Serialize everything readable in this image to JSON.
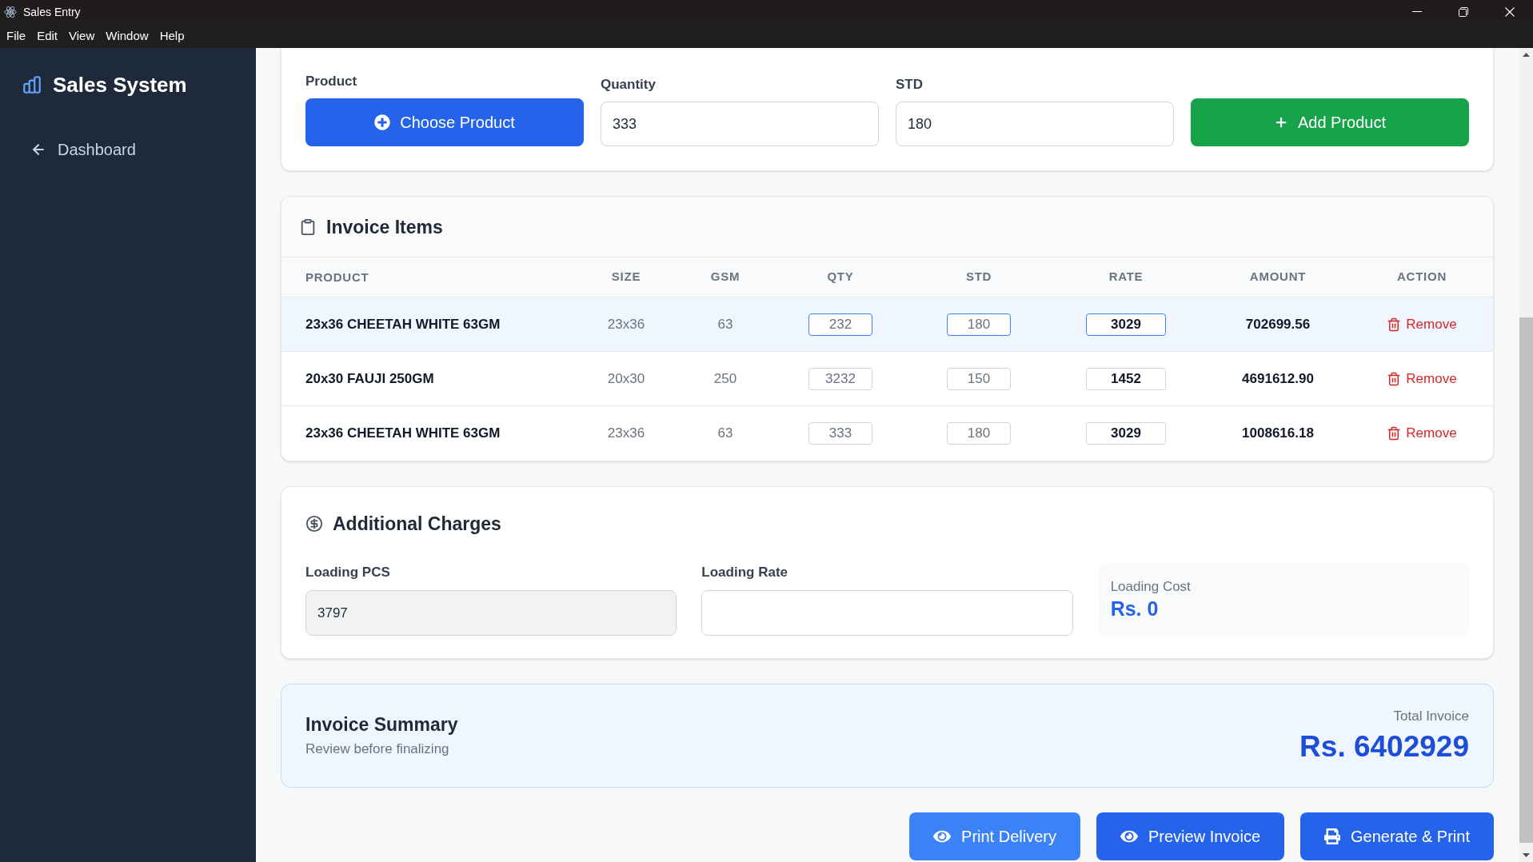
{
  "window": {
    "title": "Sales Entry"
  },
  "menu": [
    "File",
    "Edit",
    "View",
    "Window",
    "Help"
  ],
  "sidebar": {
    "brand": "Sales System",
    "items": [
      {
        "label": "Dashboard"
      }
    ]
  },
  "product_form": {
    "product": {
      "label": "Product",
      "button": "Choose Product"
    },
    "quantity": {
      "label": "Quantity",
      "value": "333"
    },
    "std": {
      "label": "STD",
      "value": "180"
    },
    "add_button": "Add Product"
  },
  "invoice_items": {
    "title": "Invoice Items",
    "columns": [
      "PRODUCT",
      "SIZE",
      "GSM",
      "QTY",
      "STD",
      "RATE",
      "AMOUNT",
      "ACTION"
    ],
    "rows": [
      {
        "product": "23x36 CHEETAH WHITE 63GM",
        "size": "23x36",
        "gsm": "63",
        "qty": "232",
        "std": "180",
        "rate": "3029",
        "amount": "702699.56",
        "action": "Remove",
        "selected": true
      },
      {
        "product": "20x30 FAUJI 250GM",
        "size": "20x30",
        "gsm": "250",
        "qty": "3232",
        "std": "150",
        "rate": "1452",
        "amount": "4691612.90",
        "action": "Remove",
        "selected": false
      },
      {
        "product": "23x36 CHEETAH WHITE 63GM",
        "size": "23x36",
        "gsm": "63",
        "qty": "333",
        "std": "180",
        "rate": "3029",
        "amount": "1008616.18",
        "action": "Remove",
        "selected": false
      }
    ]
  },
  "additional_charges": {
    "title": "Additional Charges",
    "loading_pcs": {
      "label": "Loading PCS",
      "value": "3797",
      "readonly": true
    },
    "loading_rate": {
      "label": "Loading Rate",
      "readonly": false
    },
    "loading_cost": {
      "label": "Loading Cost",
      "value": "Rs. 0"
    }
  },
  "summary": {
    "title": "Invoice Summary",
    "subtitle": "Review before finalizing",
    "total_label": "Total Invoice",
    "total": "Rs. 6402929"
  },
  "actions": [
    {
      "label": "Print Delivery",
      "kind": "delivery",
      "color": "#3b82f6"
    },
    {
      "label": "Preview Invoice",
      "kind": "preview",
      "color": "#2563eb"
    },
    {
      "label": "Generate & Print",
      "kind": "generate",
      "color": "#2563eb"
    }
  ]
}
